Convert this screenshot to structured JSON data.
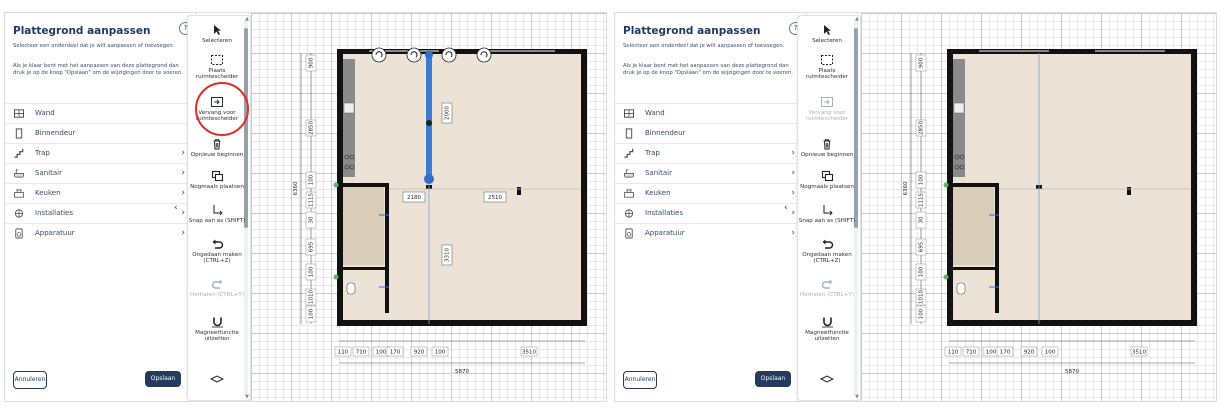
{
  "screens": [
    {
      "sidebar": {
        "title": "Plattegrond aanpassen",
        "help": "?",
        "intro": "Selecteer een onderdeel dat je wilt aanpassen of toevoegen.",
        "hint": "Als je klaar bent met het aanpassen van deze plattegrond dan druk je op de knop \"Opslaan\" om de wijzigingen door te voeren.",
        "items": [
          {
            "label": "Wand",
            "icon": "wall-icon"
          },
          {
            "label": "Binnendeur",
            "icon": "door-icon"
          },
          {
            "label": "Trap",
            "icon": "stairs-icon",
            "chevron": "›"
          },
          {
            "label": "Sanitair",
            "icon": "bath-icon",
            "chevron": "›"
          },
          {
            "label": "Keuken",
            "icon": "kitchen-icon",
            "chevron": "›"
          },
          {
            "label": "Installaties",
            "icon": "installation-icon",
            "chevron": "›"
          },
          {
            "label": "Apparatuur",
            "icon": "appliance-icon",
            "chevron": "›"
          }
        ],
        "cancel": "Annuleren",
        "save": "Opslaan",
        "collapse": "‹"
      },
      "toolbar": {
        "select": "Selecteren",
        "place_divider": "Plaats ruimtescheider",
        "replace_divider": "Vervang voor ruimtescheider",
        "restart": "Opnieuw beginnen",
        "place_again": "Nogmaals plaatsen",
        "snap": "Snap aan as (SHIFT)",
        "undo": "Ongedaan maken (CTRL+Z)",
        "redo": "Herhalen (CTRL+Y)",
        "magnet": "Magneetfunctie uitzetten"
      },
      "dimensions": {
        "left": [
          "900",
          "2850",
          "100",
          "1115",
          "30",
          "695",
          "100",
          "1010",
          "100"
        ],
        "total_vertical": "6360",
        "bottom": [
          "110",
          "710",
          "100",
          "170",
          "920",
          "100",
          "3510"
        ],
        "total_horizontal": "5870",
        "interior": [
          "2000",
          "2180",
          "2510",
          "3310"
        ]
      }
    },
    {
      "sidebar": {
        "title": "Plattegrond aanpassen",
        "help": "?",
        "intro": "Selecteer een onderdeel dat je wilt aanpassen of toevoegen.",
        "hint": "Als je klaar bent met het aanpassen van deze plattegrond dan druk je op de knop \"Opslaan\" om de wijzigingen door te voeren.",
        "items": [
          {
            "label": "Wand",
            "icon": "wall-icon"
          },
          {
            "label": "Binnendeur",
            "icon": "door-icon"
          },
          {
            "label": "Trap",
            "icon": "stairs-icon",
            "chevron": "›"
          },
          {
            "label": "Sanitair",
            "icon": "bath-icon",
            "chevron": "›"
          },
          {
            "label": "Keuken",
            "icon": "kitchen-icon",
            "chevron": "›"
          },
          {
            "label": "Installaties",
            "icon": "installation-icon",
            "chevron": "›"
          },
          {
            "label": "Apparatuur",
            "icon": "appliance-icon",
            "chevron": "›"
          }
        ],
        "cancel": "Annuleren",
        "save": "Opslaan",
        "collapse": "‹"
      },
      "toolbar": {
        "select": "Selecteren",
        "place_divider": "Plaats ruimtescheider",
        "replace_divider": "Vervang voor ruimtescheider",
        "restart": "Opnieuw beginnen",
        "place_again": "Nogmaals plaatsen",
        "snap": "Snap aan as (SHIFT)",
        "undo": "Ongedaan maken (CTRL+Z)",
        "redo": "Herhalen (CTRL+Y)",
        "magnet": "Magneetfunctie uitzetten"
      },
      "dimensions": {
        "left": [
          "900",
          "2850",
          "100",
          "1115",
          "30",
          "695",
          "100",
          "1010",
          "100"
        ],
        "total_vertical": "6360",
        "bottom": [
          "110",
          "710",
          "100",
          "170",
          "920",
          "100",
          "3510"
        ],
        "total_horizontal": "5870",
        "interior": []
      }
    }
  ],
  "colors": {
    "brand": "#243a5e",
    "selection": "#2f6fd0",
    "highlight": "#e22a2a",
    "floor": "#ece3d6",
    "tiles": "#d7cdb8",
    "kitchen": "#8a8a8a"
  }
}
